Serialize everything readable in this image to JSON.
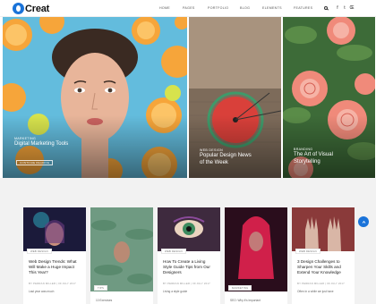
{
  "brand": {
    "name": "Creat",
    "color": "#1a73d9"
  },
  "nav": {
    "items": [
      "HOME",
      "PAGES",
      "PORTFOLIO",
      "BLOG",
      "ELEMENTS",
      "FEATURES"
    ],
    "icons": [
      "search-icon",
      "facebook-icon",
      "twitter-icon",
      "rss-icon"
    ],
    "social_glyphs": [
      "f",
      "t",
      "Œ"
    ]
  },
  "hero": {
    "slides": [
      {
        "category": "MARKETING",
        "title": "Digital Marketing Tools",
        "button": "CONTINUE READING"
      },
      {
        "category": "WEB DESIGN",
        "title": "Popular Design News of the Week"
      },
      {
        "category": "BRANDING",
        "title": "The Art of Visual Storytelling"
      }
    ]
  },
  "posts": [
    {
      "category": "WEB DESIGN",
      "title": "Web Design Trends: What Will Make a Huge Impact This Year?",
      "meta": "BY PERRAN MILLER  |  09 JULY 2017",
      "excerpt": "Last year was much"
    },
    {
      "category": "TIPS",
      "title": "",
      "meta": "",
      "excerpt": "10 Exercises"
    },
    {
      "category": "WEB DESIGN",
      "title": "How To Create a Living Style Guide Tips from Our Designers",
      "meta": "BY PERRAN MILLER  |  09 JULY 2017",
      "excerpt": "Living a style guide"
    },
    {
      "category": "MARKETING",
      "title": "",
      "meta": "",
      "excerpt": "SEO: Why it's Important"
    },
    {
      "category": "WEB DESIGN",
      "title": "3 Design Challenges to Sharpen Your Skills and Extend Your Knowledge",
      "meta": "BY PERRAN MILLER  |  09 JULY 2017",
      "excerpt": "Often in a while we just have"
    }
  ],
  "scroll_button": {
    "icon": "arrow-up-icon"
  }
}
